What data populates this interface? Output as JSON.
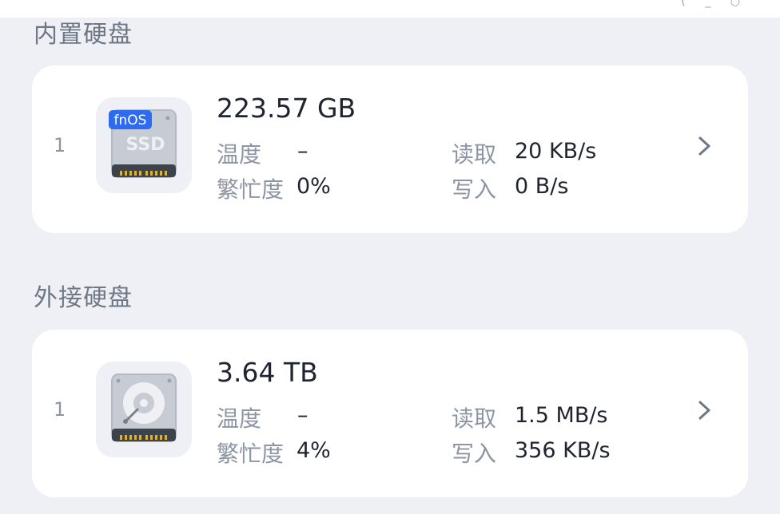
{
  "sections": [
    {
      "title": "内置硬盘",
      "disk": {
        "index": "1",
        "badge": "fnOS",
        "icon_text": "SSD",
        "icon": "ssd-drive-icon",
        "capacity": "223.57 GB",
        "temp_label": "温度",
        "temp_value": "–",
        "busy_label": "繁忙度",
        "busy_value": "0%",
        "read_label": "读取",
        "read_value": "20 KB/s",
        "write_label": "写入",
        "write_value": "0 B/s"
      }
    },
    {
      "title": "外接硬盘",
      "disk": {
        "index": "1",
        "icon": "hdd-drive-icon",
        "capacity": "3.64 TB",
        "temp_label": "温度",
        "temp_value": "–",
        "busy_label": "繁忙度",
        "busy_value": "4%",
        "read_label": "读取",
        "read_value": "1.5 MB/s",
        "write_label": "写入",
        "write_value": "356 KB/s"
      }
    }
  ],
  "colors": {
    "background": "#eef0f6",
    "card": "#ffffff",
    "label": "#8d95a3",
    "value": "#1f2430",
    "badge": "#2f6bef"
  }
}
